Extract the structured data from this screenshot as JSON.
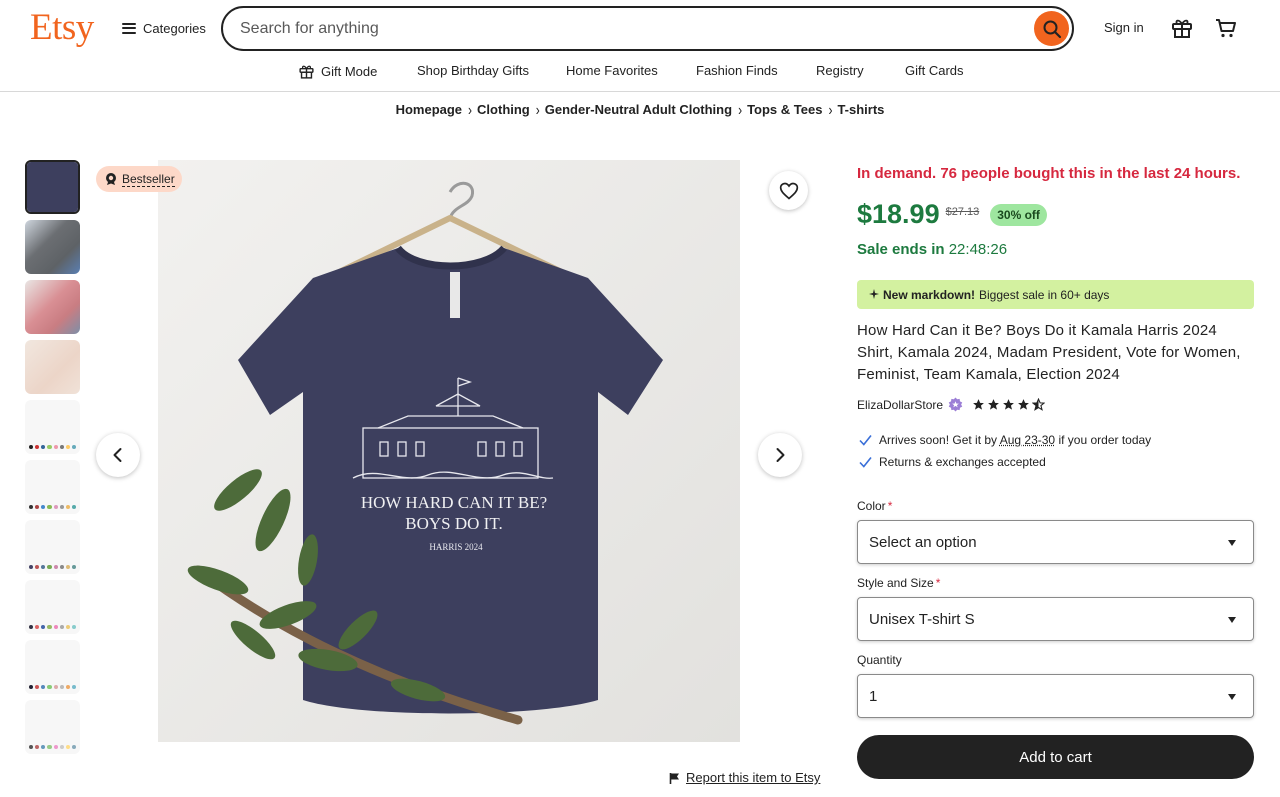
{
  "header": {
    "logo": "Etsy",
    "categories_label": "Categories",
    "search_placeholder": "Search for anything",
    "signin_label": "Sign in"
  },
  "subnav": {
    "items": [
      "Gift Mode",
      "Shop Birthday Gifts",
      "Home Favorites",
      "Fashion Finds",
      "Registry",
      "Gift Cards"
    ]
  },
  "breadcrumb": [
    "Homepage",
    "Clothing",
    "Gender-Neutral Adult Clothing",
    "Tops & Tees",
    "T-shirts"
  ],
  "gallery": {
    "badge": "Bestseller",
    "shirt_text_line1": "HOW HARD CAN IT BE?",
    "shirt_text_line2": "BOYS DO IT.",
    "shirt_text_line3": "HARRIS 2024",
    "thumbnail_count": 10
  },
  "product": {
    "demand": "In demand. 76 people bought this in the last 24 hours.",
    "price": "$18.99",
    "original_price": "$27.13",
    "discount": "30% off",
    "sale_ends_label": "Sale ends in",
    "sale_ends_time": "22:48:26",
    "markdown_bold": "New markdown!",
    "markdown_text": "Biggest sale in 60+ days",
    "title": "How Hard Can it Be? Boys Do it Kamala Harris 2024 Shirt, Kamala 2024, Madam President, Vote for Women, Feminist, Team Kamala, Election 2024",
    "shop_name": "ElizaDollarStore",
    "rating": 4.5,
    "arrives_pre": "Arrives soon! Get it by",
    "arrives_date": "Aug 23-30",
    "arrives_post": "if you order today",
    "returns": "Returns & exchanges accepted",
    "color_label": "Color",
    "color_value": "Select an option",
    "style_label": "Style and Size",
    "style_value": "Unisex T-shirt S",
    "quantity_label": "Quantity",
    "quantity_value": "1",
    "add_to_cart": "Add to cart",
    "report": "Report this item to Etsy"
  },
  "colors": {
    "brand": "#F1641E",
    "sale_green": "#1D7A3F",
    "demand_red": "#D6283F",
    "markdown_bg": "#D3F1A0",
    "discount_bg": "#9EE69F",
    "shirt": "#3D3F5E"
  }
}
